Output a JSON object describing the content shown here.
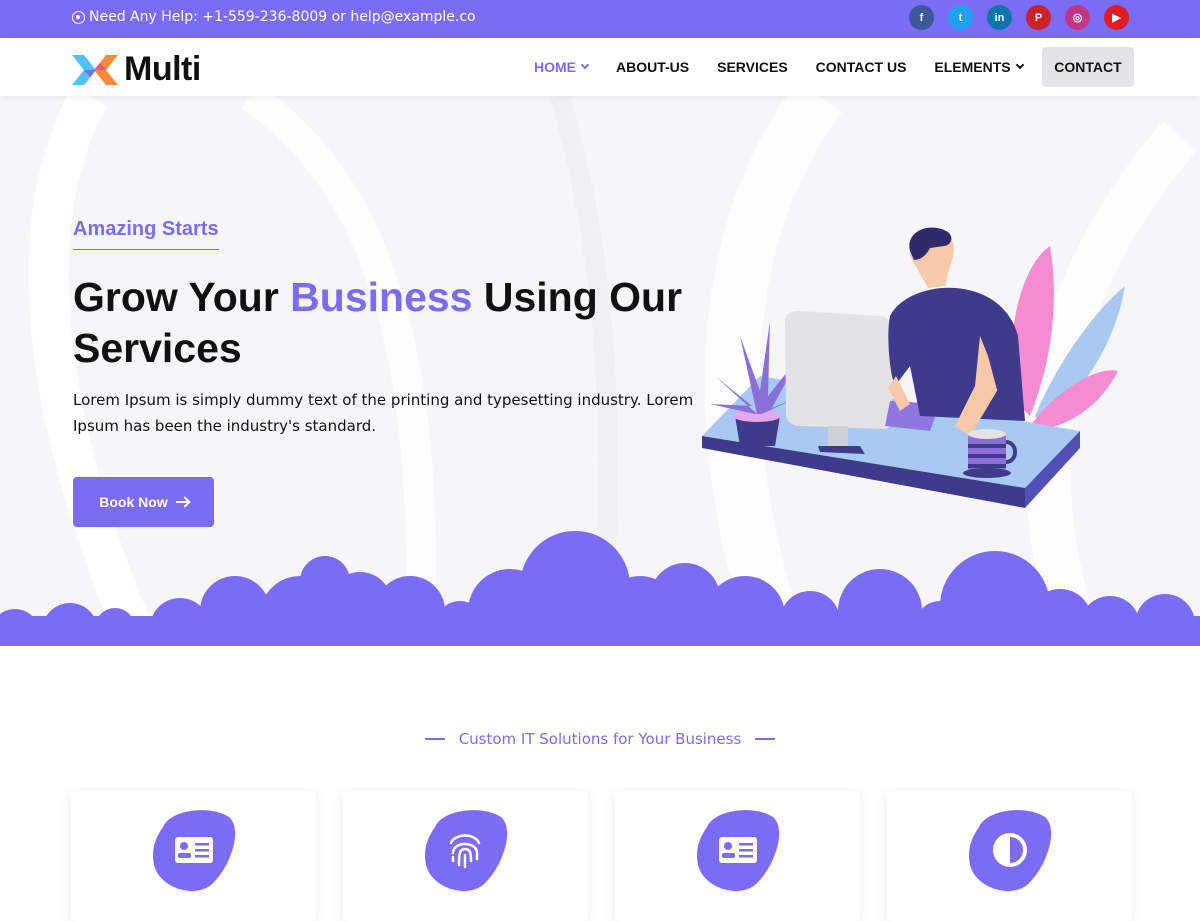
{
  "topbar": {
    "help_text": "Need Any Help: +1-559-236-8009 or help@example.co",
    "socials": [
      {
        "name": "facebook",
        "glyph": "f",
        "color": "#3b5998"
      },
      {
        "name": "twitter",
        "glyph": "t",
        "color": "#1da1f2"
      },
      {
        "name": "linkedin",
        "glyph": "in",
        "color": "#0e76a8"
      },
      {
        "name": "pinterest",
        "glyph": "P",
        "color": "#cb2027"
      },
      {
        "name": "instagram",
        "glyph": "◎",
        "color": "#c13584"
      },
      {
        "name": "youtube",
        "glyph": "▶",
        "color": "#e01b22"
      }
    ]
  },
  "header": {
    "logo_text": "Multi",
    "nav": [
      {
        "label": "HOME",
        "active": true,
        "dropdown": true
      },
      {
        "label": "ABOUT-US",
        "active": false,
        "dropdown": false
      },
      {
        "label": "SERVICES",
        "active": false,
        "dropdown": false
      },
      {
        "label": "CONTACT US",
        "active": false,
        "dropdown": false
      },
      {
        "label": "ELEMENTS",
        "active": false,
        "dropdown": true
      }
    ],
    "cta_label": "CONTACT"
  },
  "hero": {
    "eyebrow": "Amazing Starts",
    "headline_part1": "Grow Your ",
    "headline_accent": "Business",
    "headline_part2": " Using Our Services",
    "lede": "Lorem Ipsum is simply dummy text of the printing and typesetting industry. Lorem Ipsum has been the industry's standard.",
    "button_label": "Book Now"
  },
  "section": {
    "tagline": "Custom IT Solutions for Your Business",
    "cards": [
      {
        "icon": "id-card-icon"
      },
      {
        "icon": "fingerprint-icon"
      },
      {
        "icon": "id-card-icon"
      },
      {
        "icon": "contrast-icon"
      }
    ]
  },
  "colors": {
    "accent": "#7b6cf6",
    "dark": "#111111",
    "hero_bg": "#f6f6f8"
  }
}
